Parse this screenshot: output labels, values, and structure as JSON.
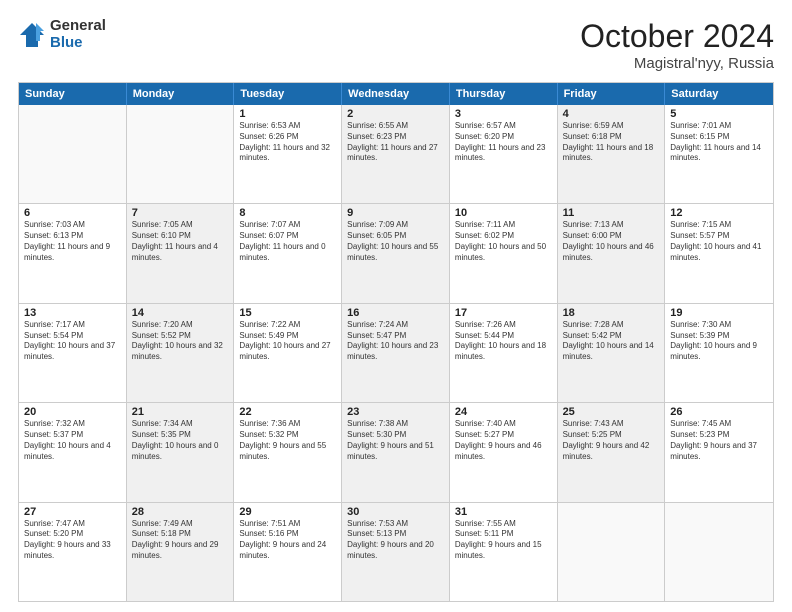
{
  "logo": {
    "general": "General",
    "blue": "Blue"
  },
  "title": "October 2024",
  "location": "Magistral'nyy, Russia",
  "days": [
    "Sunday",
    "Monday",
    "Tuesday",
    "Wednesday",
    "Thursday",
    "Friday",
    "Saturday"
  ],
  "weeks": [
    [
      {
        "day": "",
        "sunrise": "",
        "sunset": "",
        "daylight": "",
        "shaded": false,
        "empty": true
      },
      {
        "day": "",
        "sunrise": "",
        "sunset": "",
        "daylight": "",
        "shaded": false,
        "empty": true
      },
      {
        "day": "1",
        "sunrise": "Sunrise: 6:53 AM",
        "sunset": "Sunset: 6:26 PM",
        "daylight": "Daylight: 11 hours and 32 minutes.",
        "shaded": false,
        "empty": false
      },
      {
        "day": "2",
        "sunrise": "Sunrise: 6:55 AM",
        "sunset": "Sunset: 6:23 PM",
        "daylight": "Daylight: 11 hours and 27 minutes.",
        "shaded": true,
        "empty": false
      },
      {
        "day": "3",
        "sunrise": "Sunrise: 6:57 AM",
        "sunset": "Sunset: 6:20 PM",
        "daylight": "Daylight: 11 hours and 23 minutes.",
        "shaded": false,
        "empty": false
      },
      {
        "day": "4",
        "sunrise": "Sunrise: 6:59 AM",
        "sunset": "Sunset: 6:18 PM",
        "daylight": "Daylight: 11 hours and 18 minutes.",
        "shaded": true,
        "empty": false
      },
      {
        "day": "5",
        "sunrise": "Sunrise: 7:01 AM",
        "sunset": "Sunset: 6:15 PM",
        "daylight": "Daylight: 11 hours and 14 minutes.",
        "shaded": false,
        "empty": false
      }
    ],
    [
      {
        "day": "6",
        "sunrise": "Sunrise: 7:03 AM",
        "sunset": "Sunset: 6:13 PM",
        "daylight": "Daylight: 11 hours and 9 minutes.",
        "shaded": false,
        "empty": false
      },
      {
        "day": "7",
        "sunrise": "Sunrise: 7:05 AM",
        "sunset": "Sunset: 6:10 PM",
        "daylight": "Daylight: 11 hours and 4 minutes.",
        "shaded": true,
        "empty": false
      },
      {
        "day": "8",
        "sunrise": "Sunrise: 7:07 AM",
        "sunset": "Sunset: 6:07 PM",
        "daylight": "Daylight: 11 hours and 0 minutes.",
        "shaded": false,
        "empty": false
      },
      {
        "day": "9",
        "sunrise": "Sunrise: 7:09 AM",
        "sunset": "Sunset: 6:05 PM",
        "daylight": "Daylight: 10 hours and 55 minutes.",
        "shaded": true,
        "empty": false
      },
      {
        "day": "10",
        "sunrise": "Sunrise: 7:11 AM",
        "sunset": "Sunset: 6:02 PM",
        "daylight": "Daylight: 10 hours and 50 minutes.",
        "shaded": false,
        "empty": false
      },
      {
        "day": "11",
        "sunrise": "Sunrise: 7:13 AM",
        "sunset": "Sunset: 6:00 PM",
        "daylight": "Daylight: 10 hours and 46 minutes.",
        "shaded": true,
        "empty": false
      },
      {
        "day": "12",
        "sunrise": "Sunrise: 7:15 AM",
        "sunset": "Sunset: 5:57 PM",
        "daylight": "Daylight: 10 hours and 41 minutes.",
        "shaded": false,
        "empty": false
      }
    ],
    [
      {
        "day": "13",
        "sunrise": "Sunrise: 7:17 AM",
        "sunset": "Sunset: 5:54 PM",
        "daylight": "Daylight: 10 hours and 37 minutes.",
        "shaded": false,
        "empty": false
      },
      {
        "day": "14",
        "sunrise": "Sunrise: 7:20 AM",
        "sunset": "Sunset: 5:52 PM",
        "daylight": "Daylight: 10 hours and 32 minutes.",
        "shaded": true,
        "empty": false
      },
      {
        "day": "15",
        "sunrise": "Sunrise: 7:22 AM",
        "sunset": "Sunset: 5:49 PM",
        "daylight": "Daylight: 10 hours and 27 minutes.",
        "shaded": false,
        "empty": false
      },
      {
        "day": "16",
        "sunrise": "Sunrise: 7:24 AM",
        "sunset": "Sunset: 5:47 PM",
        "daylight": "Daylight: 10 hours and 23 minutes.",
        "shaded": true,
        "empty": false
      },
      {
        "day": "17",
        "sunrise": "Sunrise: 7:26 AM",
        "sunset": "Sunset: 5:44 PM",
        "daylight": "Daylight: 10 hours and 18 minutes.",
        "shaded": false,
        "empty": false
      },
      {
        "day": "18",
        "sunrise": "Sunrise: 7:28 AM",
        "sunset": "Sunset: 5:42 PM",
        "daylight": "Daylight: 10 hours and 14 minutes.",
        "shaded": true,
        "empty": false
      },
      {
        "day": "19",
        "sunrise": "Sunrise: 7:30 AM",
        "sunset": "Sunset: 5:39 PM",
        "daylight": "Daylight: 10 hours and 9 minutes.",
        "shaded": false,
        "empty": false
      }
    ],
    [
      {
        "day": "20",
        "sunrise": "Sunrise: 7:32 AM",
        "sunset": "Sunset: 5:37 PM",
        "daylight": "Daylight: 10 hours and 4 minutes.",
        "shaded": false,
        "empty": false
      },
      {
        "day": "21",
        "sunrise": "Sunrise: 7:34 AM",
        "sunset": "Sunset: 5:35 PM",
        "daylight": "Daylight: 10 hours and 0 minutes.",
        "shaded": true,
        "empty": false
      },
      {
        "day": "22",
        "sunrise": "Sunrise: 7:36 AM",
        "sunset": "Sunset: 5:32 PM",
        "daylight": "Daylight: 9 hours and 55 minutes.",
        "shaded": false,
        "empty": false
      },
      {
        "day": "23",
        "sunrise": "Sunrise: 7:38 AM",
        "sunset": "Sunset: 5:30 PM",
        "daylight": "Daylight: 9 hours and 51 minutes.",
        "shaded": true,
        "empty": false
      },
      {
        "day": "24",
        "sunrise": "Sunrise: 7:40 AM",
        "sunset": "Sunset: 5:27 PM",
        "daylight": "Daylight: 9 hours and 46 minutes.",
        "shaded": false,
        "empty": false
      },
      {
        "day": "25",
        "sunrise": "Sunrise: 7:43 AM",
        "sunset": "Sunset: 5:25 PM",
        "daylight": "Daylight: 9 hours and 42 minutes.",
        "shaded": true,
        "empty": false
      },
      {
        "day": "26",
        "sunrise": "Sunrise: 7:45 AM",
        "sunset": "Sunset: 5:23 PM",
        "daylight": "Daylight: 9 hours and 37 minutes.",
        "shaded": false,
        "empty": false
      }
    ],
    [
      {
        "day": "27",
        "sunrise": "Sunrise: 7:47 AM",
        "sunset": "Sunset: 5:20 PM",
        "daylight": "Daylight: 9 hours and 33 minutes.",
        "shaded": false,
        "empty": false
      },
      {
        "day": "28",
        "sunrise": "Sunrise: 7:49 AM",
        "sunset": "Sunset: 5:18 PM",
        "daylight": "Daylight: 9 hours and 29 minutes.",
        "shaded": true,
        "empty": false
      },
      {
        "day": "29",
        "sunrise": "Sunrise: 7:51 AM",
        "sunset": "Sunset: 5:16 PM",
        "daylight": "Daylight: 9 hours and 24 minutes.",
        "shaded": false,
        "empty": false
      },
      {
        "day": "30",
        "sunrise": "Sunrise: 7:53 AM",
        "sunset": "Sunset: 5:13 PM",
        "daylight": "Daylight: 9 hours and 20 minutes.",
        "shaded": true,
        "empty": false
      },
      {
        "day": "31",
        "sunrise": "Sunrise: 7:55 AM",
        "sunset": "Sunset: 5:11 PM",
        "daylight": "Daylight: 9 hours and 15 minutes.",
        "shaded": false,
        "empty": false
      },
      {
        "day": "",
        "sunrise": "",
        "sunset": "",
        "daylight": "",
        "shaded": true,
        "empty": true
      },
      {
        "day": "",
        "sunrise": "",
        "sunset": "",
        "daylight": "",
        "shaded": false,
        "empty": true
      }
    ]
  ]
}
